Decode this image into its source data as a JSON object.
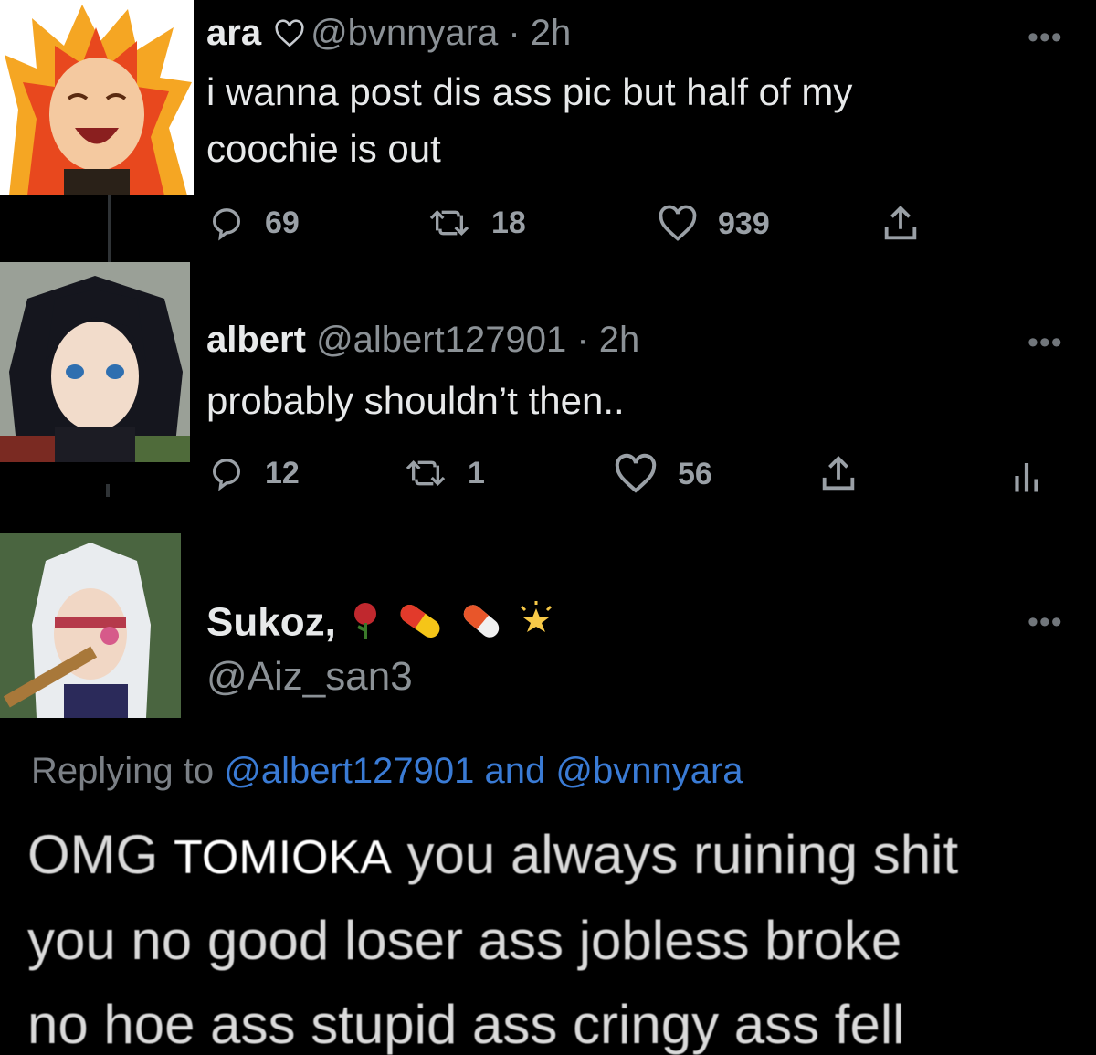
{
  "tweets": [
    {
      "name": "ara",
      "handle": "@bvnnyara",
      "time": "2h",
      "text": "i wanna post dis ass pic but half of my coochie is out",
      "line1": "i wanna post dis ass pic but half of my",
      "line2": "coochie is out",
      "replies": "69",
      "retweets": "18",
      "likes": "939"
    },
    {
      "name": "albert",
      "handle": "@albert127901",
      "time": "2h",
      "text": "probably shouldn’t then..",
      "replies": "12",
      "retweets": "1",
      "likes": "56"
    },
    {
      "name": "Sukoz,",
      "handle": "@Aiz_san3",
      "emojis": [
        "rose-emoji",
        "pill-emoji",
        "pill-emoji",
        "sparkle-star-emoji"
      ]
    }
  ],
  "reply": {
    "prefix": "Replying to",
    "user1": "@albert127901",
    "and": "and",
    "user2": "@bvnnyara"
  },
  "body": {
    "line1_start": "OMG",
    "line1_name": "TOMIOKA",
    "line1_end": "you always ruining shit",
    "line2": "you no good loser ass jobless broke",
    "line3": "no hoe ass stupid ass cringy ass fell"
  },
  "separator": "·",
  "more_label": "•••",
  "colors": {
    "background": "#000000",
    "text": "#e7e9ea",
    "muted": "#71767b",
    "link": "#3a7bd5"
  }
}
